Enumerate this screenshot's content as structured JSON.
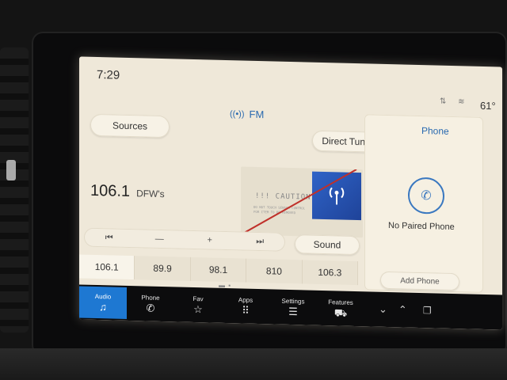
{
  "status": {
    "time": "7:29",
    "temperature": "61°"
  },
  "band": {
    "label": "FM"
  },
  "buttons": {
    "sources": "Sources",
    "direct_tune": "Direct Tune",
    "sound": "Sound",
    "add_phone": "Add Phone"
  },
  "station": {
    "frequency": "106.1",
    "name": "DFW's"
  },
  "album": {
    "caution_text": "!!! CAUTION !!!",
    "fine_print_1": "DO NOT TOUCH SENSOR CONTROL",
    "fine_print_2": "FOR ITEM TO BE REMOVED"
  },
  "controls": {
    "prev": "⏮",
    "minus": "—",
    "plus": "+",
    "next": "⏭"
  },
  "presets": [
    "106.1",
    "89.9",
    "98.1",
    "810",
    "106.3"
  ],
  "phone": {
    "title": "Phone",
    "status": "No Paired Phone"
  },
  "nav": {
    "items": [
      {
        "label": "Audio",
        "icon": "♫"
      },
      {
        "label": "Phone",
        "icon": "✆"
      },
      {
        "label": "Fav",
        "icon": "☆"
      },
      {
        "label": "Apps",
        "icon": "⠿"
      },
      {
        "label": "Settings",
        "icon": "☰"
      },
      {
        "label": "Features",
        "icon": "⛟"
      }
    ]
  },
  "colors": {
    "accent": "#1e78d2",
    "screen_bg": "#efe8d9",
    "link_blue": "#2a6ab0"
  }
}
